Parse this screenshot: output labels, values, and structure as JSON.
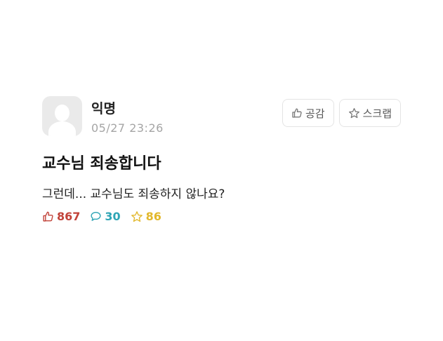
{
  "post": {
    "author": "익명",
    "timestamp": "05/27 23:26",
    "title": "교수님 죄송합니다",
    "content": "그런데... 교수님도 죄송하지 않나요?",
    "buttons": {
      "like_label": "공감",
      "scrap_label": "스크랩"
    },
    "stats": {
      "likes": "867",
      "comments": "30",
      "scraps": "86"
    }
  },
  "colors": {
    "like": "#c2433a",
    "comment": "#2fa5b5",
    "scrap": "#e2b82c",
    "timestamp": "#a5a5a5"
  },
  "icons": {
    "avatar": "anonymous-avatar",
    "like": "thumbs-up-icon",
    "comment": "speech-bubble-icon",
    "scrap": "star-icon"
  }
}
